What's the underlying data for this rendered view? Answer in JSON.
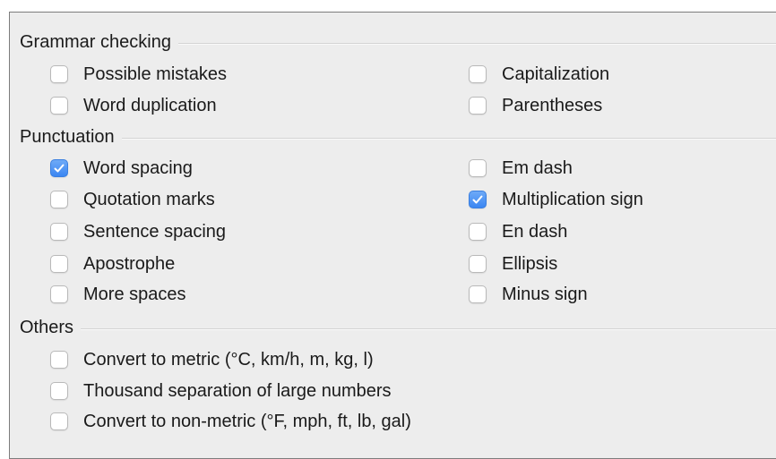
{
  "sections": [
    {
      "title": "Grammar checking",
      "options": [
        {
          "label": "Possible mistakes",
          "checked": false
        },
        {
          "label": "Capitalization",
          "checked": false
        },
        {
          "label": "Word duplication",
          "checked": false
        },
        {
          "label": "Parentheses",
          "checked": false
        }
      ]
    },
    {
      "title": "Punctuation",
      "options": [
        {
          "label": "Word spacing",
          "checked": true
        },
        {
          "label": "Em dash",
          "checked": false
        },
        {
          "label": "Quotation marks",
          "checked": false
        },
        {
          "label": "Multiplication sign",
          "checked": true
        },
        {
          "label": "Sentence spacing",
          "checked": false
        },
        {
          "label": "En dash",
          "checked": false
        },
        {
          "label": "Apostrophe",
          "checked": false
        },
        {
          "label": "Ellipsis",
          "checked": false
        },
        {
          "label": "More spaces",
          "checked": false
        },
        {
          "label": "Minus sign",
          "checked": false
        }
      ]
    },
    {
      "title": "Others",
      "options": [
        {
          "label": "Convert to metric (°C, km/h, m, kg, l)",
          "checked": false
        },
        {
          "label": "Thousand separation of large numbers",
          "checked": false
        },
        {
          "label": "Convert to non-metric (°F, mph, ft, lb, gal)",
          "checked": false
        }
      ]
    }
  ],
  "colors": {
    "panel_bg": "#ededed",
    "checkbox_checked": "#3b86f2",
    "text": "#1a1a1a"
  }
}
